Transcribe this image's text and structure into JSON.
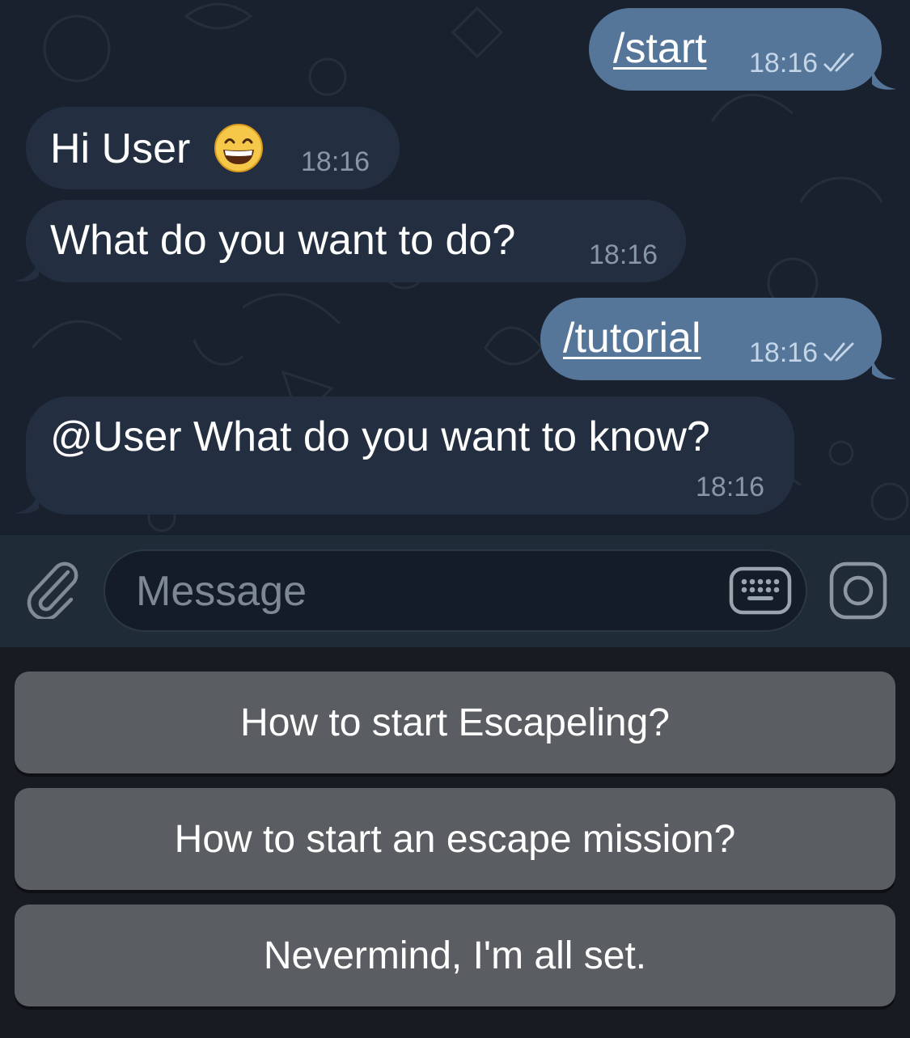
{
  "chat": {
    "messages": [
      {
        "direction": "outgoing",
        "text": "/start",
        "time": "18:16",
        "status": "read"
      },
      {
        "direction": "incoming",
        "text": "Hi User",
        "emoji": "grinning-face-with-smiling-eyes",
        "time": "18:16"
      },
      {
        "direction": "incoming",
        "text": "What do you want to do?",
        "time": "18:16"
      },
      {
        "direction": "outgoing",
        "text": "/tutorial",
        "time": "18:16",
        "status": "read"
      },
      {
        "direction": "incoming",
        "text": "@User What do you want to know?",
        "time": "18:16"
      }
    ]
  },
  "composer": {
    "placeholder": "Message",
    "icons": {
      "attach": "paperclip-icon",
      "keyboard": "keyboard-icon",
      "camera": "camera-icon"
    }
  },
  "reply_keyboard": {
    "buttons": [
      "How to start Escapeling?",
      "How to start an escape mission?",
      "Nevermind, I'm all set."
    ]
  },
  "colors": {
    "chat_background": "#18212d",
    "incoming_bubble": "#232f40",
    "outgoing_bubble": "#557599",
    "keyboard_button": "#5a5e62",
    "keyboard_background": "#181b21"
  }
}
